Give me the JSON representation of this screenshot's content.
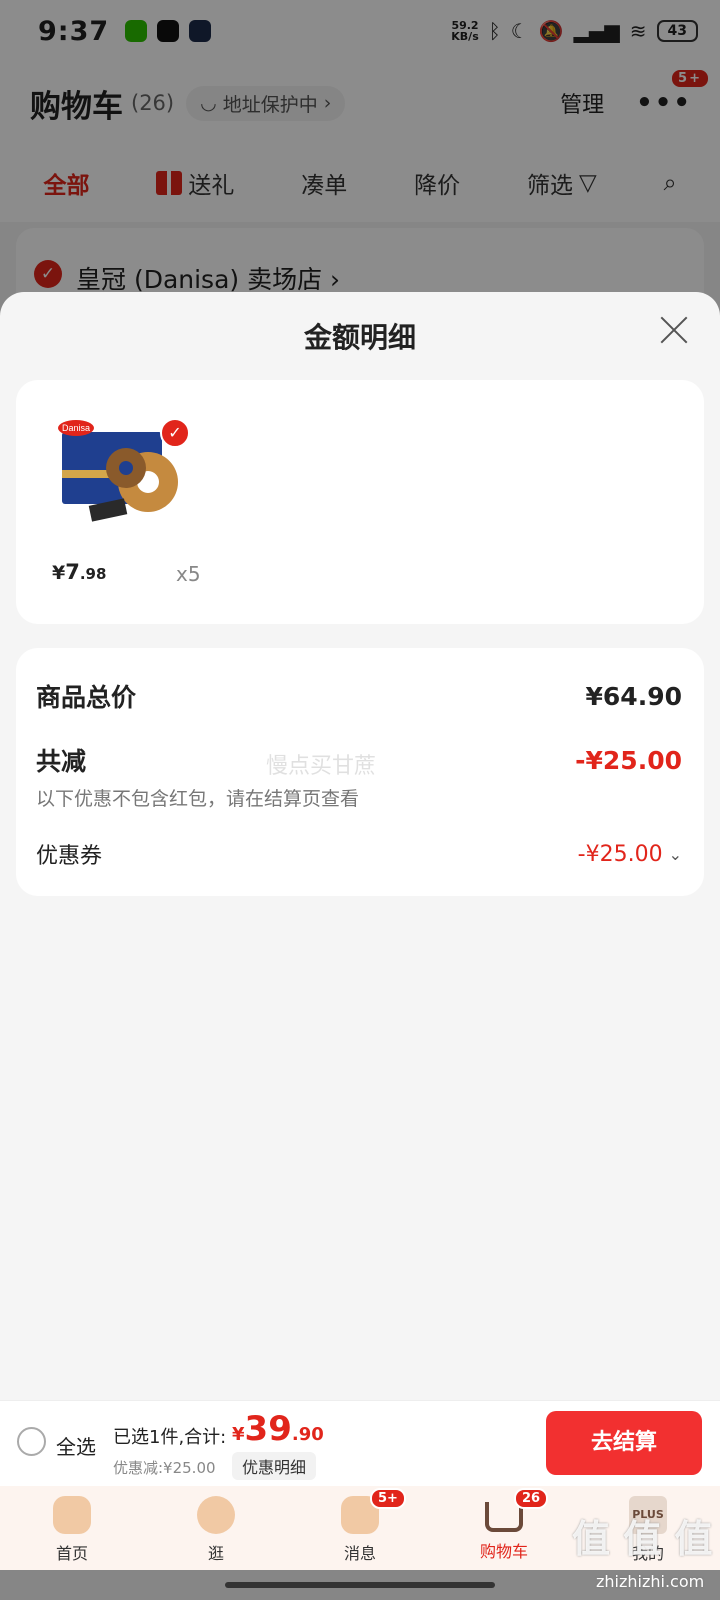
{
  "status_bar": {
    "time": "9:37",
    "net_speed_value": "59.2",
    "net_speed_unit": "KB/s",
    "battery": "43"
  },
  "header": {
    "title": "购物车",
    "count": "(26)",
    "address": "地址保护中",
    "manage": "管理",
    "more_badge": "5+"
  },
  "tabs": [
    "全部",
    "送礼",
    "凑单",
    "降价",
    "筛选"
  ],
  "shop": {
    "name": "皇冠 (Danisa) 卖场店 ›"
  },
  "sheet": {
    "title": "金额明细",
    "product": {
      "price_currency": "¥",
      "price_int": "7",
      "price_dec": ".98",
      "quantity": "x5",
      "brand_on_pack": "Danisa"
    },
    "summary": {
      "total_label": "商品总价",
      "total_value": "¥64.90",
      "reduce_label": "共减",
      "reduce_value": "-¥25.00",
      "note": "以下优惠不包含红包，请在结算页查看",
      "coupon_label": "优惠券",
      "coupon_value": "-¥25.00",
      "watermark": "慢点买甘蔗"
    }
  },
  "checkout": {
    "select_all": "全选",
    "selected_text": "已选1件,合计:",
    "total_currency": "¥",
    "total_int": "39",
    "total_dec": ".90",
    "discount": "优惠减:¥25.00",
    "detail_button": "优惠明细",
    "checkout_button": "去结算"
  },
  "nav": [
    {
      "label": "首页",
      "badge": ""
    },
    {
      "label": "逛",
      "badge": ""
    },
    {
      "label": "消息",
      "badge": "5+"
    },
    {
      "label": "购物车",
      "badge": "26"
    },
    {
      "label": "我的",
      "badge": ""
    }
  ],
  "nav_plus_text": "PLUS",
  "brand_watermark": "值 值 值",
  "brand_url": "zhizhizhi.com",
  "colors": {
    "accent": "#e1251b",
    "checkout_button": "#f23030",
    "nav_bg": "#fdf4ef"
  }
}
